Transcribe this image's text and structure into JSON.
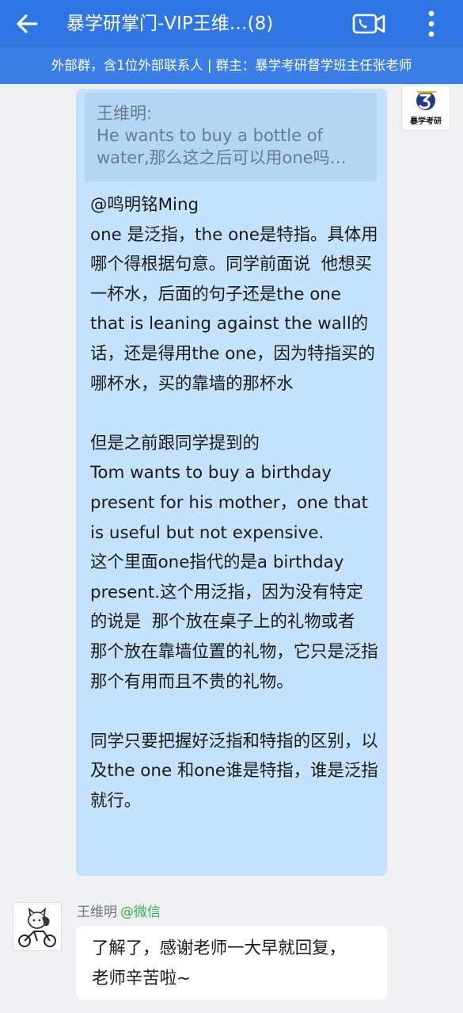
{
  "header": {
    "title": "暴学研掌门-VIP王维…(8)",
    "back_icon": "arrow-left-icon",
    "video_icon": "phone-video-icon",
    "more_icon": "more-vertical-icon",
    "accent": "#2f75e4"
  },
  "group_info": "外部群，含1位外部联系人 | 群主：暴学考研督学班主任张老师",
  "messages": [
    {
      "side": "right",
      "avatar_text": "暴学考研",
      "quote_sender": "王维明:",
      "quote_text": "He wants to buy a bottle of water,那么这之后可以用one吗…",
      "body": "@鸣明铭Ming\none 是泛指，the one是特指。具体用哪个得根据句意。同学前面说  他想买一杯水，后面的句子还是the one that is leaning against the wall的话，还是得用the one，因为特指买的哪杯水，买的靠墙的那杯水\n\n但是之前跟同学提到的\nTom wants to buy a birthday present for his mother，one that is useful but not expensive.\n这个里面one指代的是a birthday present.这个用泛指，因为没有特定的说是  那个放在桌子上的礼物或者  那个放在靠墙位置的礼物，它只是泛指那个有用而且不贵的礼物。\n\n同学只要把握好泛指和特指的区别，以及the one 和one谁是特指，谁是泛指就行。"
    },
    {
      "side": "left",
      "sender": "王维明",
      "sender_tag": "@微信",
      "body": "了解了，感谢老师一大早就回复，老师辛苦啦~"
    }
  ]
}
